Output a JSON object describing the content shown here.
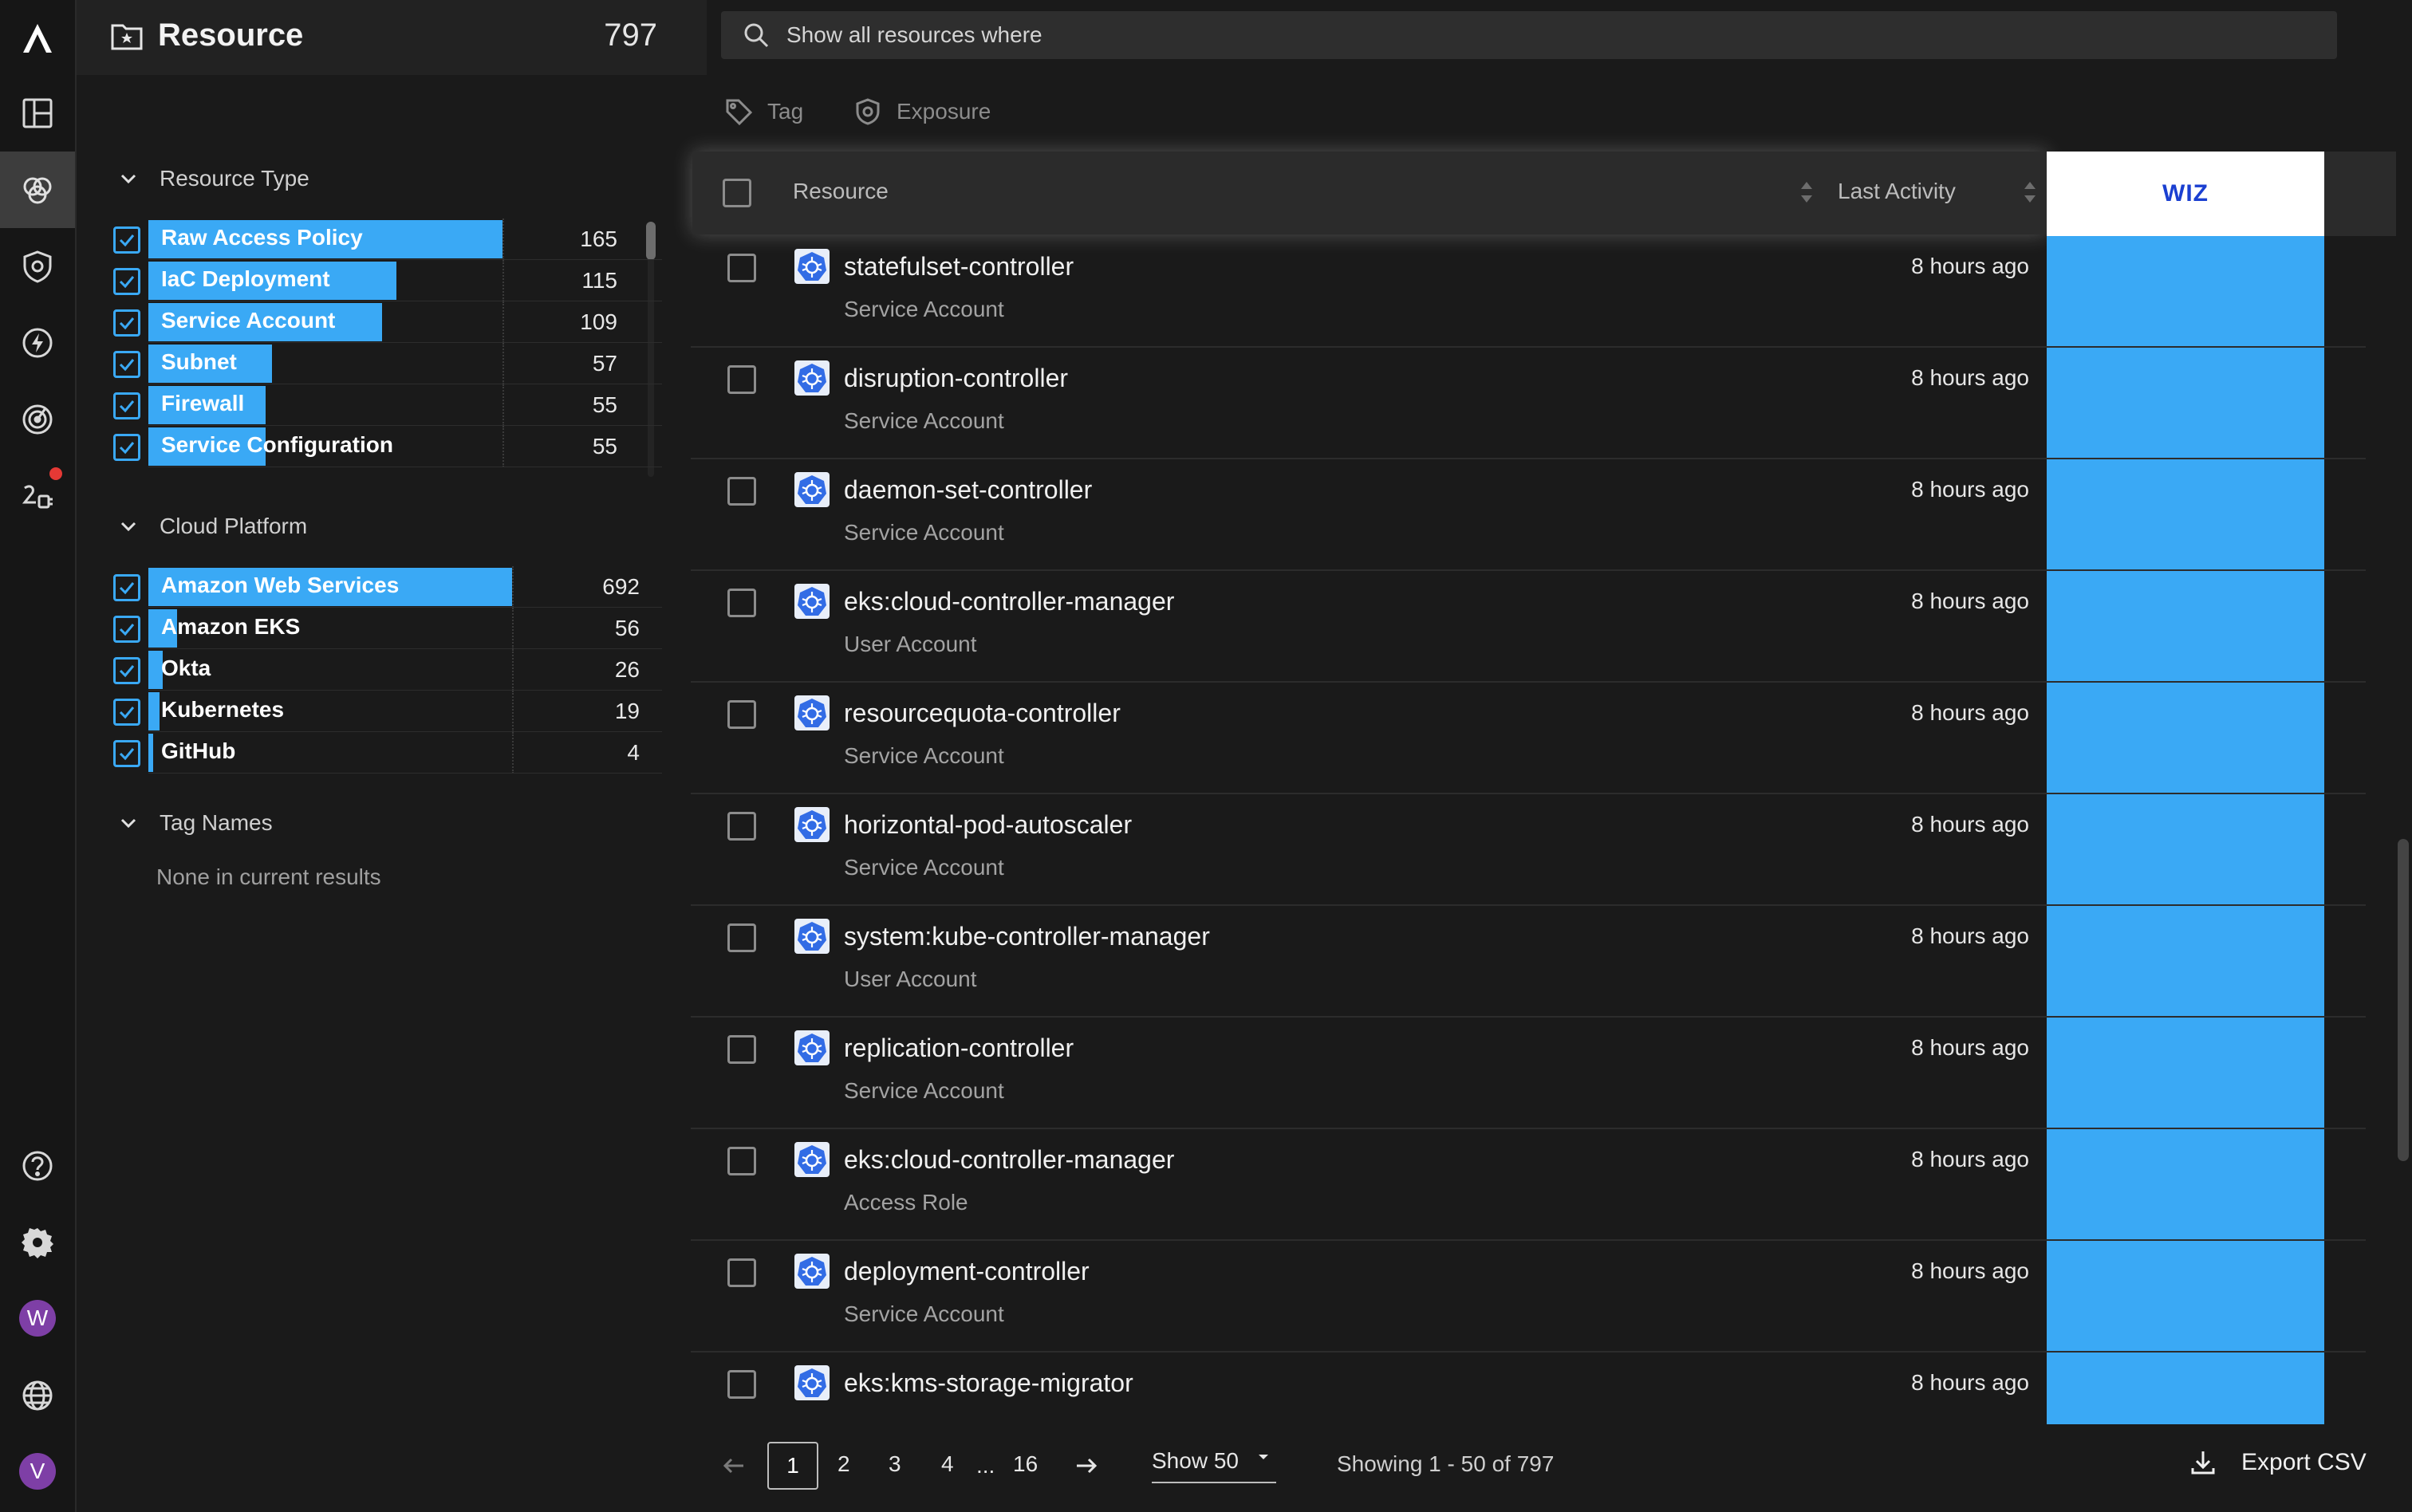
{
  "header": {
    "title": "Resource",
    "count": "797",
    "search_placeholder": "Show all resources where"
  },
  "rail": {
    "icons": [
      "logo-icon",
      "dashboard-icon",
      "resources-icon",
      "shield-icon",
      "bolt-icon",
      "radar-icon",
      "integrations-icon",
      "help-icon",
      "settings-icon",
      "globe-icon"
    ],
    "avatar_w": "W",
    "avatar_v": "V"
  },
  "filters": {
    "resource_type": {
      "title": "Resource Type",
      "items": [
        {
          "label": "Raw Access Policy",
          "count": "165",
          "fraction": 1.0
        },
        {
          "label": "IaC Deployment",
          "count": "115",
          "fraction": 0.7
        },
        {
          "label": "Service Account",
          "count": "109",
          "fraction": 0.66
        },
        {
          "label": "Subnet",
          "count": "57",
          "fraction": 0.35
        },
        {
          "label": "Firewall",
          "count": "55",
          "fraction": 0.33
        },
        {
          "label": "Service Configuration",
          "count": "55",
          "fraction": 0.33
        }
      ]
    },
    "cloud_platform": {
      "title": "Cloud Platform",
      "items": [
        {
          "label": "Amazon Web Services",
          "count": "692",
          "fraction": 1.0
        },
        {
          "label": "Amazon EKS",
          "count": "56",
          "fraction": 0.08
        },
        {
          "label": "Okta",
          "count": "26",
          "fraction": 0.04
        },
        {
          "label": "Kubernetes",
          "count": "19",
          "fraction": 0.03
        },
        {
          "label": "GitHub",
          "count": "4",
          "fraction": 0.01
        }
      ]
    },
    "tag_names": {
      "title": "Tag Names",
      "empty_text": "None in current results"
    }
  },
  "quick_filters": {
    "tag": "Tag",
    "exposure": "Exposure"
  },
  "table": {
    "columns": {
      "resource": "Resource",
      "last_activity": "Last Activity",
      "wiz": "WIZ"
    },
    "wiz_color": "#3aa9f5",
    "rows": [
      {
        "name": "statefulset-controller",
        "type": "Service Account",
        "last_activity": "8 hours ago"
      },
      {
        "name": "disruption-controller",
        "type": "Service Account",
        "last_activity": "8 hours ago"
      },
      {
        "name": "daemon-set-controller",
        "type": "Service Account",
        "last_activity": "8 hours ago"
      },
      {
        "name": "eks:cloud-controller-manager",
        "type": "User Account",
        "last_activity": "8 hours ago"
      },
      {
        "name": "resourcequota-controller",
        "type": "Service Account",
        "last_activity": "8 hours ago"
      },
      {
        "name": "horizontal-pod-autoscaler",
        "type": "Service Account",
        "last_activity": "8 hours ago"
      },
      {
        "name": "system:kube-controller-manager",
        "type": "User Account",
        "last_activity": "8 hours ago"
      },
      {
        "name": "replication-controller",
        "type": "Service Account",
        "last_activity": "8 hours ago"
      },
      {
        "name": "eks:cloud-controller-manager",
        "type": "Access Role",
        "last_activity": "8 hours ago"
      },
      {
        "name": "deployment-controller",
        "type": "Service Account",
        "last_activity": "8 hours ago"
      },
      {
        "name": "eks:kms-storage-migrator",
        "type": "",
        "last_activity": "8 hours ago"
      }
    ]
  },
  "footer": {
    "pages": [
      "1",
      "2",
      "3",
      "4",
      "...",
      "16"
    ],
    "current_page": "1",
    "show_label": "Show 50",
    "showing_text": "Showing 1 - 50 of 797",
    "export_label": "Export CSV"
  },
  "colors": {
    "accent": "#3aa9f5",
    "background": "#1a1a1a",
    "notification": "#e53935",
    "avatar": "#7e3fa6",
    "wiz_logo": "#1a3fd1"
  }
}
